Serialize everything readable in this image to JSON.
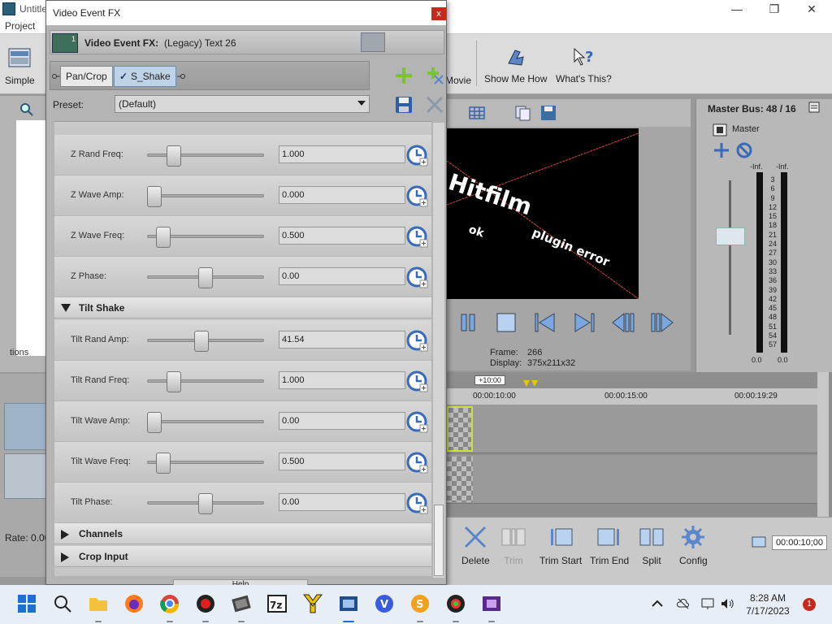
{
  "app": {
    "title": "Untitle",
    "menu": [
      "Project"
    ],
    "toolbar": {
      "simple_label": "Simple",
      "movie_label": "Movie",
      "show_me_how_label": "Show Me How",
      "whats_this_label": "What's This?"
    },
    "left": {
      "options_label": "tions",
      "rate_label": "Rate: 0.00"
    },
    "preview": {
      "text_main": "Hitfilm",
      "text_sub": "plugin error",
      "text_ok": "ok",
      "frame_label": "Frame:",
      "frame_value": "266",
      "display_label": "Display:",
      "display_value": "375x211x32"
    },
    "master_bus": {
      "title": "Master Bus: 48 / 16",
      "name": "Master",
      "inf_left": "-Inf.",
      "inf_right": "-Inf.",
      "zero_left": "0.0",
      "zero_right": "0.0",
      "scale": [
        "3",
        "6",
        "9",
        "12",
        "15",
        "18",
        "21",
        "24",
        "27",
        "30",
        "33",
        "36",
        "39",
        "42",
        "45",
        "48",
        "51",
        "54",
        "57"
      ]
    },
    "timeline": {
      "offset_label": "+10:00",
      "ruler": [
        "00:00:10:00",
        "00:00:15:00",
        "00:00:19:29"
      ]
    },
    "tools": {
      "delete": "Delete",
      "trim": "Trim",
      "trim_start": "Trim Start",
      "trim_end": "Trim End",
      "split": "Split",
      "config": "Config",
      "time": "00:00:10;00"
    }
  },
  "dialog": {
    "title": "Video Event FX",
    "close": "x",
    "fx_label": "Video Event FX:",
    "fx_value": "(Legacy) Text 26",
    "fx_badge": "1",
    "chain": [
      {
        "label": "Pan/Crop",
        "active": false
      },
      {
        "label": "S_Shake",
        "active": true
      }
    ],
    "preset_label": "Preset:",
    "preset_value": "(Default)",
    "params": [
      {
        "label": "Z Rand Freq:",
        "value": "1.000",
        "pos": 0.19
      },
      {
        "label": "Z Wave Amp:",
        "value": "0.000",
        "pos": 0.0
      },
      {
        "label": "Z Wave Freq:",
        "value": "0.500",
        "pos": 0.09
      },
      {
        "label": "Z Phase:",
        "value": "0.00",
        "pos": 0.5
      }
    ],
    "section_tilt": "Tilt Shake",
    "tilt_params": [
      {
        "label": "Tilt Rand Amp:",
        "value": "41.54",
        "pos": 0.46
      },
      {
        "label": "Tilt Rand Freq:",
        "value": "1.000",
        "pos": 0.19
      },
      {
        "label": "Tilt Wave Amp:",
        "value": "0.00",
        "pos": 0.0
      },
      {
        "label": "Tilt Wave Freq:",
        "value": "0.500",
        "pos": 0.09
      },
      {
        "label": "Tilt Phase:",
        "value": "0.00",
        "pos": 0.5
      }
    ],
    "section_channels": "Channels",
    "section_crop": "Crop Input",
    "help": "Help"
  },
  "taskbar": {
    "time": "8:28 AM",
    "date": "7/17/2023",
    "notifications": "1"
  },
  "colors": {
    "accent": "#1e5fb4",
    "close_red": "#c42b1c"
  }
}
